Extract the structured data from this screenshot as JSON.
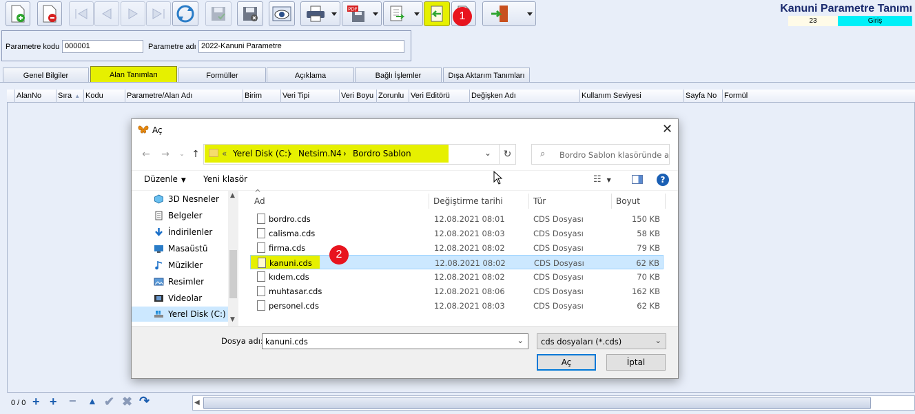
{
  "window": {
    "title": "Kanuni Parametre Tanımı",
    "record_no": "23",
    "mode": "Giriş"
  },
  "toolbar": {
    "buttons": [
      {
        "name": "new-button",
        "icon": "new-document-icon"
      },
      {
        "name": "delete-button",
        "icon": "delete-document-icon"
      },
      {
        "name": "first-button",
        "icon": "first-record-icon"
      },
      {
        "name": "prev-button",
        "icon": "prev-record-icon"
      },
      {
        "name": "next-button",
        "icon": "next-record-icon"
      },
      {
        "name": "last-button",
        "icon": "last-record-icon"
      },
      {
        "name": "refresh-button",
        "icon": "refresh-icon"
      },
      {
        "name": "save-button",
        "icon": "save-icon"
      },
      {
        "name": "cancel-save-button",
        "icon": "cancel-save-icon"
      },
      {
        "name": "preview-button",
        "icon": "eye-icon"
      },
      {
        "name": "print-button",
        "icon": "printer-icon"
      },
      {
        "name": "pdf-button",
        "icon": "pdf-icon"
      },
      {
        "name": "export-button",
        "icon": "export-icon"
      },
      {
        "name": "import-button",
        "icon": "import-icon"
      },
      {
        "name": "blank-doc-button",
        "icon": "blank-document-icon"
      },
      {
        "name": "exit-button",
        "icon": "exit-door-icon"
      }
    ],
    "pdf_badge": "PDF",
    "step1": "1"
  },
  "form": {
    "code_label": "Parametre kodu",
    "code_value": "000001",
    "name_label": "Parametre adı",
    "name_value": "2022-Kanuni Parametre"
  },
  "tabs": [
    "Genel Bilgiler",
    "Alan Tanımları",
    "Formüller",
    "Açıklama",
    "Bağlı İşlemler",
    "Dışa Aktarım Tanımları"
  ],
  "grid": {
    "columns": [
      "AlanNo",
      "Sıra",
      "Kodu",
      "Parametre/Alan Adı",
      "Birim",
      "Veri Tipi",
      "Veri Boyu",
      "Zorunlu",
      "Veri Editörü",
      "Değişken Adı",
      "Kullanım Seviyesi",
      "Sayfa No",
      "Formül"
    ],
    "record_count": "0 / 0"
  },
  "dialog": {
    "title": "Aç",
    "breadcrumb": [
      "«",
      "Yerel Disk (C:)",
      "›",
      "Netsim.N4",
      "›",
      "Bordro Sablon"
    ],
    "search_placeholder": "Bordro Sablon klasöründe ara",
    "organize": "Düzenle",
    "new_folder": "Yeni klasör",
    "sidebar": [
      "3D Nesneler",
      "Belgeler",
      "İndirilenler",
      "Masaüstü",
      "Müzikler",
      "Resimler",
      "Videolar",
      "Yerel Disk (C:)"
    ],
    "headers": [
      "Ad",
      "Değiştirme tarihi",
      "Tür",
      "Boyut"
    ],
    "files": [
      {
        "name": "bordro.cds",
        "date": "12.08.2021 08:01",
        "type": "CDS Dosyası",
        "size": "150 KB"
      },
      {
        "name": "calisma.cds",
        "date": "12.08.2021 08:03",
        "type": "CDS Dosyası",
        "size": "58 KB"
      },
      {
        "name": "firma.cds",
        "date": "12.08.2021 08:02",
        "type": "CDS Dosyası",
        "size": "79 KB"
      },
      {
        "name": "kanuni.cds",
        "date": "12.08.2021 08:02",
        "type": "CDS Dosyası",
        "size": "62 KB"
      },
      {
        "name": "kıdem.cds",
        "date": "12.08.2021 08:02",
        "type": "CDS Dosyası",
        "size": "70 KB"
      },
      {
        "name": "muhtasar.cds",
        "date": "12.08.2021 08:06",
        "type": "CDS Dosyası",
        "size": "162 KB"
      },
      {
        "name": "personel.cds",
        "date": "12.08.2021 08:03",
        "type": "CDS Dosyası",
        "size": "62 KB"
      }
    ],
    "filename_label": "Dosya adı:",
    "filename_value": "kanuni.cds",
    "filter_value": "cds dosyaları (*.cds)",
    "open_button": "Aç",
    "cancel_button": "İptal",
    "step2": "2"
  },
  "colors": {
    "highlight": "#e6f000",
    "badge": "#e8141e",
    "title": "#1a2a6e",
    "mode_bg": "#00f0f8",
    "selection": "#cce8ff"
  }
}
